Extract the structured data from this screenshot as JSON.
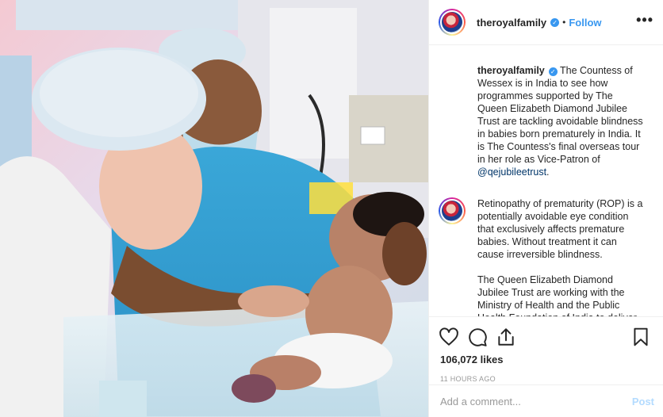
{
  "post": {
    "username": "theroyalfamily",
    "follow_label": "Follow",
    "separator": "•",
    "more_label": "•••",
    "verified_glyph": "✓"
  },
  "caption": {
    "username": "theroyalfamily",
    "text": "The Countess of Wessex is in India to see how programmes supported by The Queen Elizabeth Diamond Jubilee Trust are tackling avoidable blindness in babies born prematurely in India. It is The Countess's final overseas tour in her role as Vice-Patron of ",
    "mention": "@qejubileetrust",
    "end": "."
  },
  "comment_paragraphs": [
    "Retinopathy of prematurity (ROP) is a potentially avoidable eye condition that exclusively affects premature babies. Without treatment it can cause irreversible blindness.",
    "The Queen Elizabeth Diamond Jubilee Trust are working with the Ministry of Health and the Public Health Foundation of India to deliver vital"
  ],
  "actions": {
    "icons": [
      "heart-icon",
      "comment-icon",
      "share-icon",
      "bookmark-icon"
    ]
  },
  "likes": "106,072 likes",
  "timestamp": "11 HOURS AGO",
  "add_comment": {
    "placeholder": "Add a comment...",
    "post_label": "Post"
  },
  "colors": {
    "link_blue": "#3897f0",
    "mention_blue": "#003569",
    "post_disabled": "#b3dbff",
    "muted": "#999999"
  }
}
